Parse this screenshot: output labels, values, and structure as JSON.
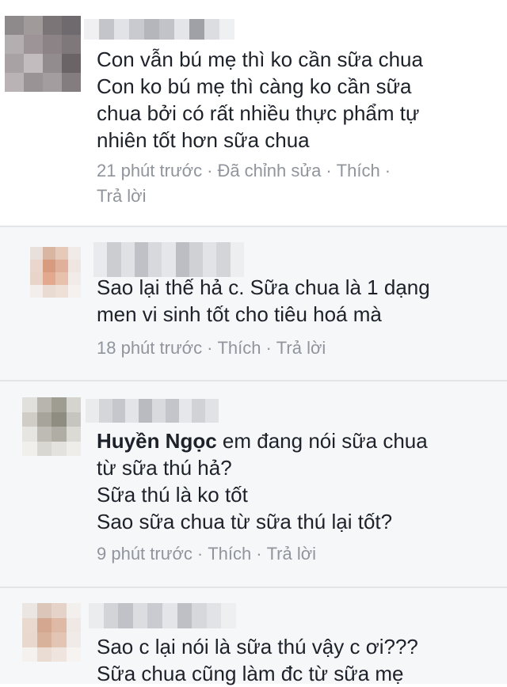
{
  "comments": [
    {
      "lines": [
        "Con vẫn bú mẹ thì ko cần sữa chua",
        "Con ko bú mẹ thì càng ko cần sữa",
        "chua bởi có rất nhiều thực phẩm tự",
        "nhiên tốt hơn sữa chua"
      ],
      "time": "21 phút trước",
      "edited": "Đã chỉnh sửa",
      "like": "Thích",
      "reply": "Trả lời"
    },
    {
      "lines": [
        "Sao lại thế hả c. Sữa chua là 1 dạng",
        "men vi sinh tốt cho tiêu hoá mà"
      ],
      "time": "18 phút trước",
      "like": "Thích",
      "reply": "Trả lời"
    },
    {
      "mention": "Huyền Ngọc",
      "lines": [
        " em đang nói sữa chua",
        "từ sữa thú hả?",
        "Sữa thú là ko tốt",
        "Sao sữa chua từ sữa thú lại tốt?"
      ],
      "time": "9 phút trước",
      "like": "Thích",
      "reply": "Trả lời"
    },
    {
      "lines": [
        "Sao c lại nói là sữa thú vậy c ơi???",
        "Sữa chua cũng làm đc từ sữa mẹ"
      ]
    }
  ],
  "meta_separator": "·",
  "avatar_palettes": [
    [
      "#8e8a8c",
      "#a09a9b",
      "#7b7577",
      "#6f6a6d",
      "#b3aeb0",
      "#9c9496",
      "#8b8385",
      "#7e787a",
      "#a8a2a4",
      "#c2bcbe",
      "#938c8e",
      "#6a6466",
      "#b9b3b5",
      "#9a9395",
      "#a49d9f",
      "#847d80"
    ],
    [
      "#e9e0dc",
      "#d9b6a2",
      "#e6c9b8",
      "#f0ebe9",
      "#ead6cc",
      "#d79c80",
      "#e0b09a",
      "#efe6e2",
      "#e8d4c8",
      "#e2a98e",
      "#e8c1ad",
      "#f1ece9",
      "#f3eeec",
      "#eadbd2",
      "#efe0d7",
      "#f5f1ef"
    ],
    [
      "#e1e0dc",
      "#b7b5ad",
      "#9f9c92",
      "#d5d4cf",
      "#cfcdc6",
      "#a7a59b",
      "#8f8c82",
      "#c7c5bf",
      "#e6e5e1",
      "#bdbbb3",
      "#b0ada4",
      "#dbdad5",
      "#f0efec",
      "#d8d7d2",
      "#e3e2de",
      "#eeedea"
    ],
    [
      "#ece6e3",
      "#dcc6ba",
      "#e5d3c9",
      "#f2efed",
      "#e9d9cf",
      "#d3a790",
      "#ddb9a6",
      "#efe8e4",
      "#e8d8ce",
      "#d9b29c",
      "#e2c5b5",
      "#f0ebe8",
      "#f4f1ef",
      "#eadcd3",
      "#efe4de",
      "#f6f3f1"
    ]
  ],
  "name_blur_palettes": [
    [
      "#f0f0f2",
      "#c4c5ca",
      "#e2e3e6",
      "#c9cacf",
      "#b4b6bb",
      "#c2c3c8",
      "#e4e5e8",
      "#9fa1a7",
      "#dcdde0",
      "#eff0f2"
    ],
    [
      "#e9eaed",
      "#cbcdd1",
      "#dfe1e4",
      "#bfc1c6",
      "#d7d9dc",
      "#e4e6e9",
      "#bcbec3",
      "#cfd1d5",
      "#e1e3e6",
      "#d3d5d9",
      "#edeef0"
    ],
    [
      "#eaebed",
      "#d4d6d9",
      "#c5c7cc",
      "#e3e4e7",
      "#b9bbc0",
      "#d8dadd",
      "#c3c5ca",
      "#e6e7ea",
      "#d0d2d6",
      "#e1e2e5"
    ],
    [
      "#ebecee",
      "#d2d4d8",
      "#c0c2c7",
      "#dcdde0",
      "#cacbd0",
      "#e4e5e8",
      "#bfc0c5",
      "#d7d8dc",
      "#e2e3e6",
      "#eeeff1"
    ]
  ]
}
